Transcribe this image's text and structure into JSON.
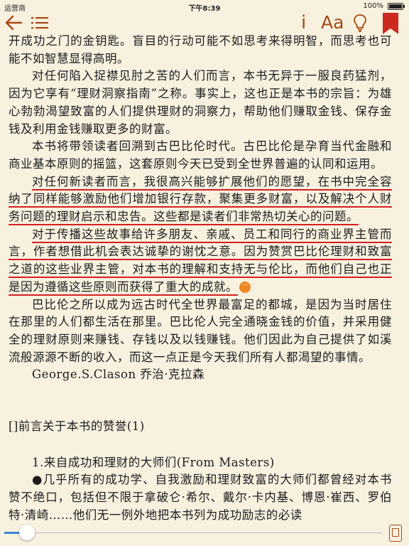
{
  "status": {
    "carrier": "运营商",
    "time": "下午8:39",
    "battery": "100%"
  },
  "toolbar": {
    "info_label": "i",
    "font_label": "Aa"
  },
  "colors": {
    "accent": "#a64a14",
    "highlight": "#d42020",
    "progress": "#3a86d9",
    "note_dot": "#ee8822"
  },
  "reader": {
    "p1": "开成功之门的金钥匙。盲目的行动可能不如思考来得明智，而思考也可能不如智慧显得高明。",
    "p2": "对任何陷入捉襟见肘之苦的人们而言，本书无异于一服良药猛剂，因为它享有“理财洞察指南”之称。事实上，这也正是本书的宗旨：为雄心勃勃渴望致富的人们提供理财的洞察力，帮助他们赚取金钱、保存金钱及利用金钱赚取更多的财富。",
    "p3": "本书将带领读者回溯到古巴比伦时代。古巴比伦是孕育当代金融和商业基本原则的摇篮，这套原则今天已受到全世界普遍的认同和运用。",
    "p4": "对任何新读者而言，我很高兴能够扩展他们的愿望，在书中完全容纳了同样能够激励他们增加银行存款，聚集更多财富，以及解决个人财务问题的理财启示和忠告。这些都是读者们非常热切关心的问题。",
    "p5": "对于传播这些故事给许多朋友、亲戚、员工和同行的商业界主管而言，作者想借此机会表达诚挚的谢忱之意。因为赞赏巴比伦理财和致富之道的这些业界主管，对本书的理解和支持无与伦比，而他们自己也正是因为遵循这些原则而获得了重大的成就。",
    "note_dot": "···",
    "p6": "巴比伦之所以成为远古时代全世界最富足的都城，是因为当时居住在那里的人们都生活在那里。巴比伦人完全通晓金钱的价值，并采用健全的理财原则来赚钱、存钱以及以钱赚钱。他们因此为自己提供了如溪流般源源不断的收入，而这一点正是今天我们所有人都渴望的事情。",
    "author": "George.S.Clason 乔治·克拉森",
    "section_title": "[]前言关于本书的赞誉(1)",
    "subsection_title": "1.来自成功和理财的大师们(From Masters)",
    "p7": "●几乎所有的成功学、自我激励和理财致富的大师们都曾经对本书赞不绝口，包括但不限于拿破仑·希尔、戴尔·卡内基、博恩·崔西、罗伯特·清崎……他们无一例外地把本书列为成功励志的必读"
  },
  "progress": {
    "fraction": 0.06
  }
}
